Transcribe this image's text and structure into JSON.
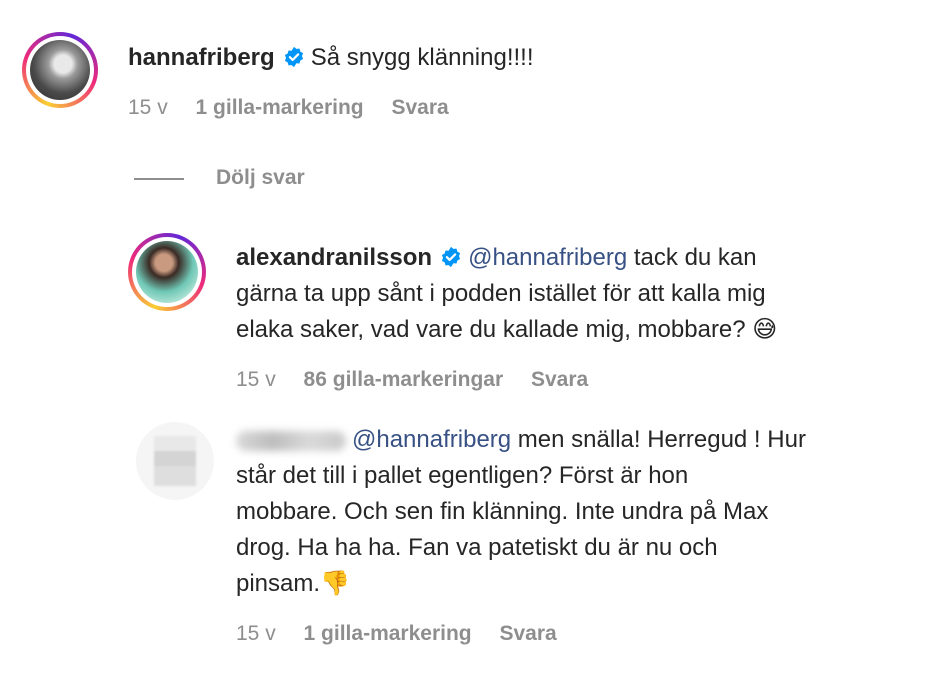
{
  "comments": [
    {
      "username": "hannafriberg",
      "verified": true,
      "text": "Så snygg klänning!!!!",
      "time": "15 v",
      "likes": "1 gilla-markering",
      "reply": "Svara"
    }
  ],
  "thread": {
    "hide_replies": "Dölj svar"
  },
  "replies": [
    {
      "username": "alexandranilsson",
      "verified": true,
      "mention": "@hannafriberg",
      "line1": " tack du kan",
      "line2": "gärna ta upp sånt i podden istället för att kalla mig",
      "line3": "elaka saker, vad vare du kallade mig, mobbare? 😅",
      "time": "15 v",
      "likes": "86 gilla-markeringar",
      "reply": "Svara"
    },
    {
      "username_hidden": true,
      "mention": "@hannafriberg",
      "line1": " men snälla! Herregud ! Hur",
      "line2": "står det till i pallet egentligen? Först är hon",
      "line3": "mobbare. Och sen fin klänning. Inte undra på Max",
      "line4": "drog. Ha ha ha. Fan va patetiskt du är nu och",
      "line5": "pinsam.👎",
      "time": "15 v",
      "likes": "1 gilla-markering",
      "reply": "Svara"
    }
  ],
  "colors": {
    "mention": "#385185",
    "meta": "#8e8e8e",
    "verified": "#0095f6"
  }
}
